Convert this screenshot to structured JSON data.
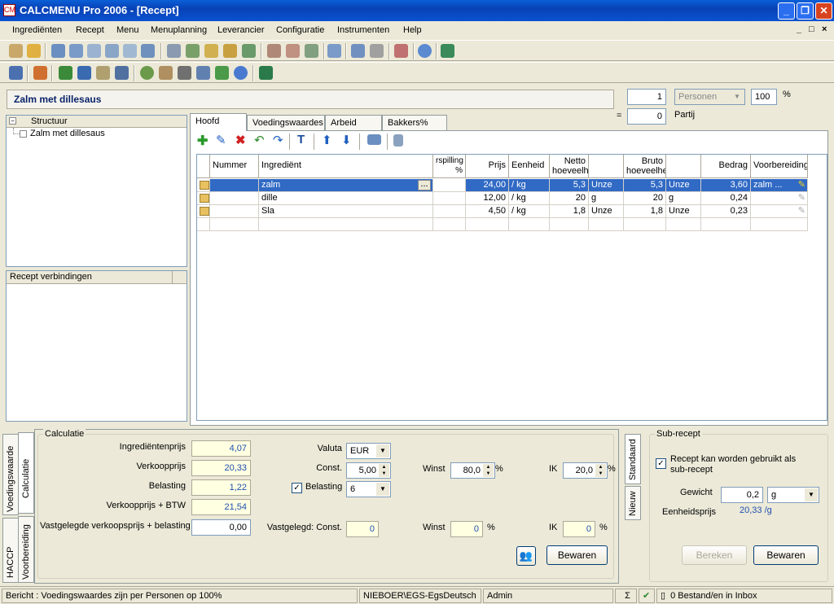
{
  "window": {
    "title": "CALCMENU Pro 2006 - [Recept]",
    "logo": "CM",
    "mdi": [
      "_",
      "□",
      "×"
    ]
  },
  "menu": [
    "Ingrediënten",
    "Recept",
    "Menu",
    "Menuplanning",
    "Leverancier",
    "Configuratie",
    "Instrumenten",
    "Help"
  ],
  "recipe": {
    "name": "Zalm met dillesaus",
    "qty": "1",
    "unit": "Personen",
    "percent": "100",
    "percent_sign": "%",
    "eq": "=",
    "partij_qty": "0",
    "partij_label": "Partij"
  },
  "tree": {
    "header": "Structuur",
    "item": "Zalm met dillesaus",
    "links_header": "Recept verbindingen"
  },
  "tabs": [
    "Hoofd",
    "Voedingswaardes",
    "Arbeid",
    "Bakkers%"
  ],
  "grid": {
    "headers": {
      "nummer": "Nummer",
      "ingredient": "Ingrediënt",
      "verspilling": "rspilling %",
      "prijs": "Prijs",
      "eenheid": "Eenheid",
      "netto": "Netto hoeveelheid",
      "bruto": "Bruto hoeveelheid",
      "bedrag": "Bedrag",
      "voorbereiding": "Voorbereiding"
    },
    "rows": [
      {
        "nummer": "",
        "ingredient": "zalm",
        "verspilling": "",
        "prijs": "24,00",
        "eenheid": "/ kg",
        "netto": "5,3",
        "netto_unit": "Unze",
        "bruto": "5,3",
        "bruto_unit": "Unze",
        "bedrag": "3,60",
        "voorbereiding": "zalm ..."
      },
      {
        "nummer": "",
        "ingredient": "dille",
        "verspilling": "",
        "prijs": "12,00",
        "eenheid": "/ kg",
        "netto": "20",
        "netto_unit": "g",
        "bruto": "20",
        "bruto_unit": "g",
        "bedrag": "0,24",
        "voorbereiding": ""
      },
      {
        "nummer": "",
        "ingredient": "Sla",
        "verspilling": "",
        "prijs": "4,50",
        "eenheid": "/ kg",
        "netto": "1,8",
        "netto_unit": "Unze",
        "bruto": "1,8",
        "bruto_unit": "Unze",
        "bedrag": "0,23",
        "voorbereiding": ""
      }
    ],
    "ellipsis": "..."
  },
  "calc": {
    "group": "Calculatie",
    "ingredientenprijs_label": "Ingrediëntenprijs",
    "ingredientenprijs": "4,07",
    "verkoopprijs_label": "Verkoopprijs",
    "verkoopprijs": "20,33",
    "belasting_label": "Belasting",
    "belasting": "1,22",
    "verkoopbtw_label": "Verkoopprijs + BTW",
    "verkoopbtw": "21,54",
    "vast_label": "Vastgelegde verkoopsprijs + belasting",
    "vast": "0,00",
    "valuta_label": "Valuta",
    "valuta": "EUR",
    "const_label": "Const.",
    "const": "5,00",
    "belasting2_label": "Belasting",
    "belasting2": "6",
    "vastconst_label": "Vastgelegd: Const.",
    "vastconst": "0",
    "winst_label": "Winst",
    "winst": "80,0",
    "winst2": "0",
    "ik_label": "IK",
    "ik": "20,0",
    "ik2": "0",
    "pct": "%",
    "bewaren": "Bewaren"
  },
  "vtabs_left": [
    "Voedingswaarde",
    "Calculatie",
    "HACCP",
    "Voorbereiding"
  ],
  "vtabs_right": [
    "Standaard",
    "Nieuw"
  ],
  "sub": {
    "group": "Sub-recept",
    "check_label": "Recept kan worden gebruikt als sub-recept",
    "gewicht_label": "Gewicht",
    "gewicht": "0,2",
    "gewicht_unit": "g",
    "eenheid_label": "Eenheidsprijs",
    "eenheid": "20,33 /g",
    "bereken": "Bereken",
    "bewaren": "Bewaren"
  },
  "status": {
    "bericht": "Bericht : Voedingswaardes zijn per Personen op 100%",
    "server": "NIEBOER\\EGS-EgsDeutsch",
    "user": "Admin",
    "sigma": "Σ",
    "inbox": "0 Bestand/en in Inbox"
  }
}
